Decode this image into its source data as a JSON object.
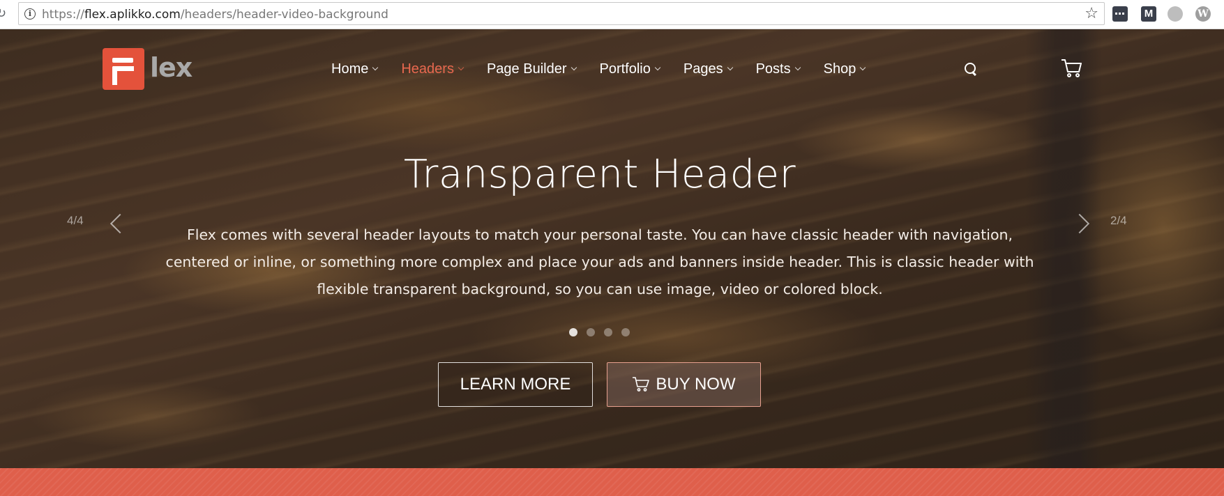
{
  "browser": {
    "url_prefix": "https://",
    "url_host": "flex.aplikko.com",
    "url_path": "/headers/header-video-background",
    "ext_icons": [
      "more-icon",
      "medium-icon",
      "wordpress-gray-icon",
      "wordpress-icon"
    ],
    "ext_medium_letter": "M",
    "ext_wp_letter": "W"
  },
  "site": {
    "logo_text": "lex",
    "brand_color": "#e4523b"
  },
  "nav": {
    "items": [
      {
        "label": "Home",
        "active": false
      },
      {
        "label": "Headers",
        "active": true
      },
      {
        "label": "Page Builder",
        "active": false
      },
      {
        "label": "Portfolio",
        "active": false
      },
      {
        "label": "Pages",
        "active": false
      },
      {
        "label": "Posts",
        "active": false
      },
      {
        "label": "Shop",
        "active": false
      }
    ],
    "active_color": "#e8684f"
  },
  "slider": {
    "prev_counter": "4/4",
    "next_counter": "2/4",
    "title": "Transparent Header",
    "text": "Flex comes with several header layouts to match your personal taste. You can have classic header with navigation, centered or inline, or something more complex and place your ads and banners inside header. This is classic header with flexible transparent background, so you can use image, video or colored block.",
    "slide_count": 4,
    "active_slide": 1,
    "buttons": {
      "learn_more": "LEARN MORE",
      "buy_now": "BUY NOW"
    }
  },
  "colors": {
    "accent": "#e8684f",
    "band": "#df5f4b"
  }
}
